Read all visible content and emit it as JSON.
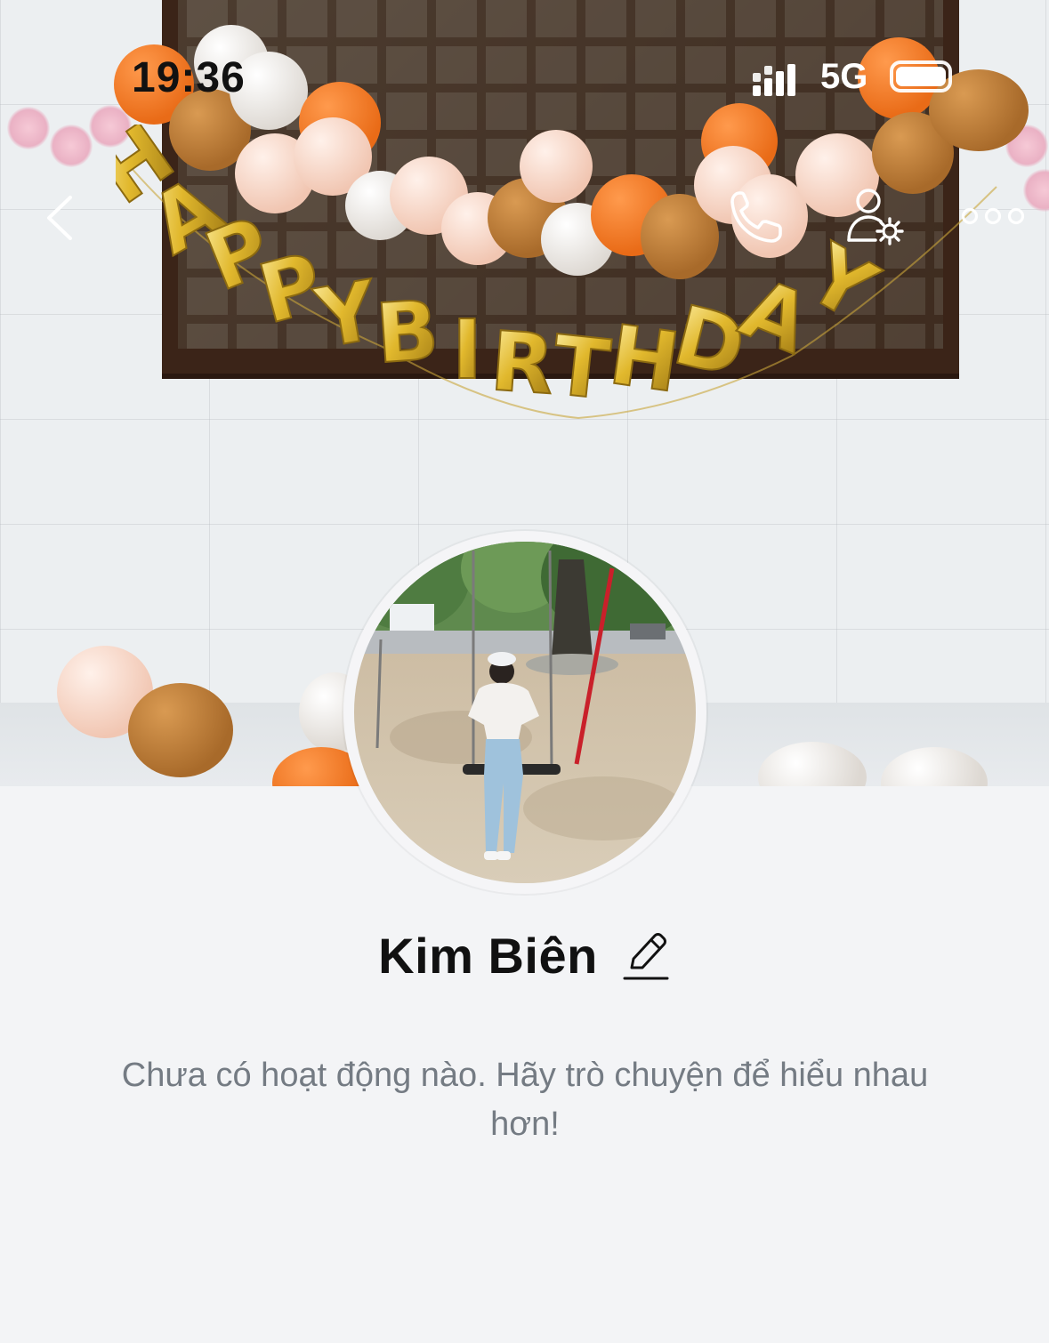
{
  "status_bar": {
    "time": "19:36",
    "network": "5G",
    "signal_icon": "cellular-signal-icon",
    "battery_icon": "battery-icon",
    "battery_level": 1.0
  },
  "cover": {
    "banner_text": "HAPPY BIRTHDAY"
  },
  "nav": {
    "back_icon": "chevron-left-icon",
    "call_icon": "phone-icon",
    "settings_icon": "user-settings-icon",
    "more_icon": "more-options-icon"
  },
  "profile": {
    "name": "Kim Biên",
    "edit_icon": "pencil-icon"
  },
  "feed": {
    "empty_message": "Chưa có hoạt động nào. Hãy trò chuyện để hiểu nhau hơn!"
  },
  "colors": {
    "background": "#f3f4f6",
    "text_primary": "#111111",
    "text_secondary": "#747b83",
    "icon_white": "#ffffff"
  }
}
